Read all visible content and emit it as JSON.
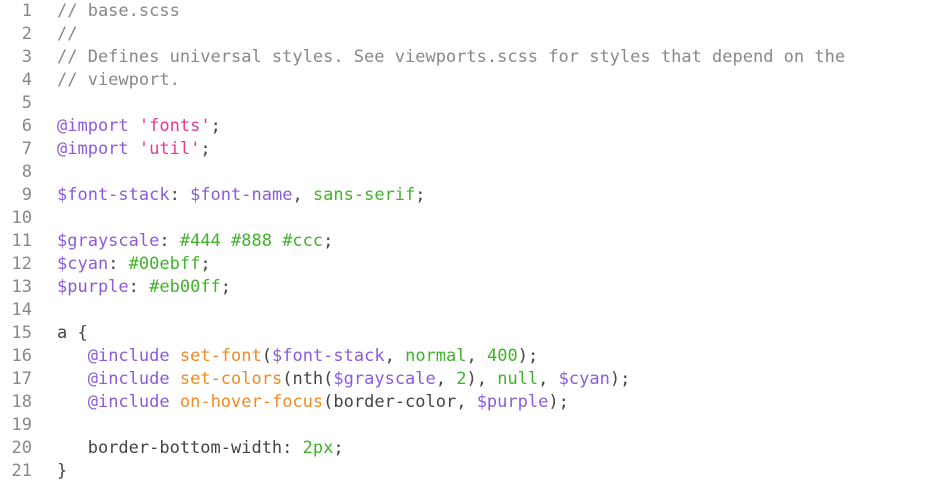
{
  "editor": {
    "lines": [
      {
        "n": "1",
        "tokens": [
          {
            "t": "// base.scss",
            "k": "comment"
          }
        ]
      },
      {
        "n": "2",
        "tokens": [
          {
            "t": "//",
            "k": "comment"
          }
        ]
      },
      {
        "n": "3",
        "tokens": [
          {
            "t": "// Defines universal styles. See viewports.scss for styles that depend on the",
            "k": "comment"
          }
        ]
      },
      {
        "n": "4",
        "tokens": [
          {
            "t": "// viewport.",
            "k": "comment"
          }
        ]
      },
      {
        "n": "5",
        "tokens": []
      },
      {
        "n": "6",
        "tokens": [
          {
            "t": "@import",
            "k": "directive"
          },
          {
            "t": " ",
            "k": "plain"
          },
          {
            "t": "'fonts'",
            "k": "string"
          },
          {
            "t": ";",
            "k": "plain"
          }
        ]
      },
      {
        "n": "7",
        "tokens": [
          {
            "t": "@import",
            "k": "directive"
          },
          {
            "t": " ",
            "k": "plain"
          },
          {
            "t": "'util'",
            "k": "string"
          },
          {
            "t": ";",
            "k": "plain"
          }
        ]
      },
      {
        "n": "8",
        "tokens": []
      },
      {
        "n": "9",
        "tokens": [
          {
            "t": "$font-stack",
            "k": "var"
          },
          {
            "t": ": ",
            "k": "plain"
          },
          {
            "t": "$font-name",
            "k": "var"
          },
          {
            "t": ", ",
            "k": "plain"
          },
          {
            "t": "sans-serif",
            "k": "value"
          },
          {
            "t": ";",
            "k": "plain"
          }
        ]
      },
      {
        "n": "10",
        "tokens": []
      },
      {
        "n": "11",
        "tokens": [
          {
            "t": "$grayscale",
            "k": "var"
          },
          {
            "t": ": ",
            "k": "plain"
          },
          {
            "t": "#444 #888 #ccc",
            "k": "value"
          },
          {
            "t": ";",
            "k": "plain"
          }
        ]
      },
      {
        "n": "12",
        "tokens": [
          {
            "t": "$cyan",
            "k": "var"
          },
          {
            "t": ": ",
            "k": "plain"
          },
          {
            "t": "#00ebff",
            "k": "value"
          },
          {
            "t": ";",
            "k": "plain"
          }
        ]
      },
      {
        "n": "13",
        "tokens": [
          {
            "t": "$purple",
            "k": "var"
          },
          {
            "t": ": ",
            "k": "plain"
          },
          {
            "t": "#eb00ff",
            "k": "value"
          },
          {
            "t": ";",
            "k": "plain"
          }
        ]
      },
      {
        "n": "14",
        "tokens": []
      },
      {
        "n": "15",
        "tokens": [
          {
            "t": "a {",
            "k": "plain"
          }
        ]
      },
      {
        "n": "16",
        "tokens": [
          {
            "t": "   ",
            "k": "plain"
          },
          {
            "t": "@include",
            "k": "directive"
          },
          {
            "t": " ",
            "k": "plain"
          },
          {
            "t": "set-font",
            "k": "func"
          },
          {
            "t": "(",
            "k": "plain"
          },
          {
            "t": "$font-stack",
            "k": "var"
          },
          {
            "t": ", ",
            "k": "plain"
          },
          {
            "t": "normal",
            "k": "value"
          },
          {
            "t": ", ",
            "k": "plain"
          },
          {
            "t": "400",
            "k": "value"
          },
          {
            "t": ");",
            "k": "plain"
          }
        ]
      },
      {
        "n": "17",
        "tokens": [
          {
            "t": "   ",
            "k": "plain"
          },
          {
            "t": "@include",
            "k": "directive"
          },
          {
            "t": " ",
            "k": "plain"
          },
          {
            "t": "set-colors",
            "k": "func"
          },
          {
            "t": "(nth(",
            "k": "plain"
          },
          {
            "t": "$grayscale",
            "k": "var"
          },
          {
            "t": ", ",
            "k": "plain"
          },
          {
            "t": "2",
            "k": "value"
          },
          {
            "t": "), ",
            "k": "plain"
          },
          {
            "t": "null",
            "k": "value"
          },
          {
            "t": ", ",
            "k": "plain"
          },
          {
            "t": "$cyan",
            "k": "var"
          },
          {
            "t": ");",
            "k": "plain"
          }
        ]
      },
      {
        "n": "18",
        "tokens": [
          {
            "t": "   ",
            "k": "plain"
          },
          {
            "t": "@include",
            "k": "directive"
          },
          {
            "t": " ",
            "k": "plain"
          },
          {
            "t": "on-hover-focus",
            "k": "func"
          },
          {
            "t": "(border-color, ",
            "k": "plain"
          },
          {
            "t": "$purple",
            "k": "var"
          },
          {
            "t": ");",
            "k": "plain"
          }
        ]
      },
      {
        "n": "19",
        "tokens": []
      },
      {
        "n": "20",
        "tokens": [
          {
            "t": "   border-bottom-width: ",
            "k": "plain"
          },
          {
            "t": "2px",
            "k": "value"
          },
          {
            "t": ";",
            "k": "plain"
          }
        ]
      },
      {
        "n": "21",
        "tokens": [
          {
            "t": "}",
            "k": "plain"
          }
        ]
      }
    ]
  }
}
